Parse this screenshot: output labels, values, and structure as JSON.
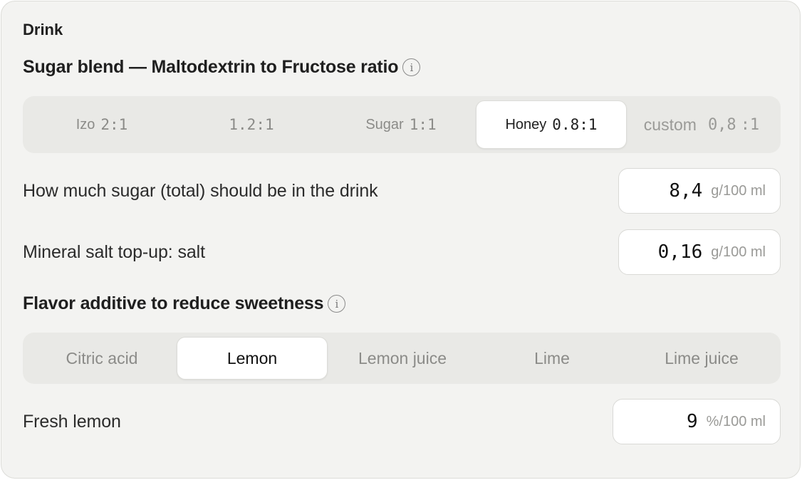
{
  "section_title": "Drink",
  "sugar_blend": {
    "heading": "Sugar blend — Maltodextrin to Fructose ratio",
    "info_icon": "i",
    "options": [
      {
        "name": "Izo",
        "ratio": "2:1"
      },
      {
        "name": "",
        "ratio": "1.2:1"
      },
      {
        "name": "Sugar",
        "ratio": "1:1"
      },
      {
        "name": "Honey",
        "ratio": "0.8:1"
      }
    ],
    "selected": "Honey",
    "custom": {
      "label": "custom",
      "value": "0,8",
      "suffix": ":1"
    }
  },
  "sugar_total": {
    "label": "How much sugar (total) should be in the drink",
    "value": "8,4",
    "unit": "g/100 ml"
  },
  "salt": {
    "label": "Mineral salt top-up: salt",
    "value": "0,16",
    "unit": "g/100 ml"
  },
  "flavor": {
    "heading": "Flavor additive to reduce sweetness",
    "info_icon": "i",
    "options": [
      "Citric acid",
      "Lemon",
      "Lemon juice",
      "Lime",
      "Lime juice"
    ],
    "selected": "Lemon"
  },
  "fresh_lemon": {
    "label": "Fresh lemon",
    "value": "9",
    "unit": "%/100 ml"
  },
  "colors": {
    "background": "#f3f3f1",
    "segment_bg": "#e9e9e6",
    "active_bg": "#ffffff",
    "muted_text": "#8b8b88"
  }
}
